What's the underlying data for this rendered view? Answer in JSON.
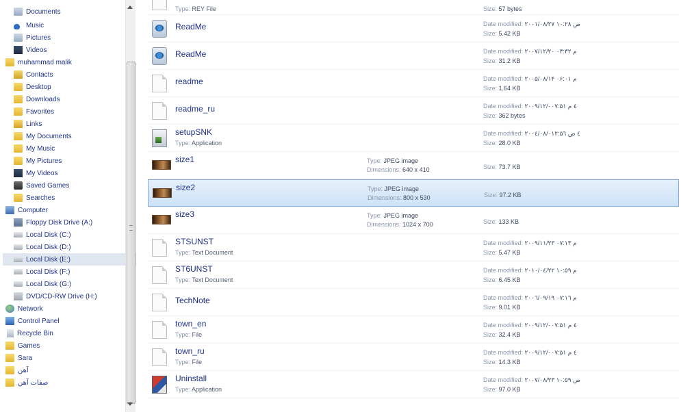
{
  "nav": {
    "items": [
      {
        "label": "Documents",
        "icon": "documents-library-icon",
        "selected": false
      },
      {
        "label": "Music",
        "icon": "music-library-icon",
        "selected": false
      },
      {
        "label": "Pictures",
        "icon": "pictures-library-icon",
        "selected": false
      },
      {
        "label": "Videos",
        "icon": "videos-library-icon",
        "selected": false
      },
      {
        "label": "muhammad malik",
        "icon": "user-folder-icon",
        "selected": false
      },
      {
        "label": "Contacts",
        "icon": "contacts-folder-icon",
        "selected": false
      },
      {
        "label": "Desktop",
        "icon": "desktop-folder-icon",
        "selected": false
      },
      {
        "label": "Downloads",
        "icon": "downloads-folder-icon",
        "selected": false
      },
      {
        "label": "Favorites",
        "icon": "favorites-folder-icon",
        "selected": false
      },
      {
        "label": "Links",
        "icon": "links-folder-icon",
        "selected": false
      },
      {
        "label": "My Documents",
        "icon": "folder-icon",
        "selected": false
      },
      {
        "label": "My Music",
        "icon": "folder-icon",
        "selected": false
      },
      {
        "label": "My Pictures",
        "icon": "folder-icon",
        "selected": false
      },
      {
        "label": "My Videos",
        "icon": "videos-folder-icon",
        "selected": false
      },
      {
        "label": "Saved Games",
        "icon": "saved-games-folder-icon",
        "selected": false
      },
      {
        "label": "Searches",
        "icon": "searches-folder-icon",
        "selected": false
      },
      {
        "label": "Computer",
        "icon": "computer-icon",
        "selected": false
      },
      {
        "label": "Floppy Disk Drive (A:)",
        "icon": "floppy-drive-icon",
        "selected": false
      },
      {
        "label": "Local Disk (C:)",
        "icon": "drive-icon",
        "selected": false
      },
      {
        "label": "Local Disk (D:)",
        "icon": "drive-icon",
        "selected": false
      },
      {
        "label": "Local Disk (E:)",
        "icon": "drive-icon",
        "selected": true
      },
      {
        "label": "Local Disk (F:)",
        "icon": "drive-icon",
        "selected": false
      },
      {
        "label": "Local Disk (G:)",
        "icon": "drive-icon",
        "selected": false
      },
      {
        "label": "DVD/CD-RW Drive (H:)",
        "icon": "dvd-drive-icon",
        "selected": false
      },
      {
        "label": "Network",
        "icon": "network-icon",
        "selected": false
      },
      {
        "label": "Control Panel",
        "icon": "control-panel-icon",
        "selected": false
      },
      {
        "label": "Recycle Bin",
        "icon": "recycle-bin-icon",
        "selected": false
      },
      {
        "label": "Games",
        "icon": "folder-icon",
        "selected": false
      },
      {
        "label": "Sara",
        "icon": "folder-icon",
        "selected": false
      },
      {
        "label": "آهن",
        "icon": "folder-icon",
        "selected": false
      },
      {
        "label": "صفات آهن",
        "icon": "folder-icon",
        "selected": false
      }
    ]
  },
  "files": [
    {
      "name": "",
      "type_label": "Type:",
      "type": "REY File",
      "size_label": "Size:",
      "size": "57 bytes",
      "icon": "document-icon"
    },
    {
      "name": "ReadMe",
      "date_label": "Date modified:",
      "date": "۲۰۰۱/۰۸/۲۷ ص ۱۰:۲۸",
      "size_label": "Size:",
      "size": "5.42 KB",
      "icon": "readme-icon"
    },
    {
      "name": "ReadMe",
      "date_label": "Date modified:",
      "date": "۲۰۰۷/۱۲/۲۰ م ۰۳:۳۲",
      "size_label": "Size:",
      "size": "31.2 KB",
      "icon": "readme-icon"
    },
    {
      "name": "readme",
      "date_label": "Date modified:",
      "date": "۲۰۰۵/۰۸/۱۴ م ۰۶:۰۱",
      "size_label": "Size:",
      "size": "1.64 KB",
      "icon": "document-icon"
    },
    {
      "name": "readme_ru",
      "date_label": "Date modified:",
      "date": "۲۰۰۹/۱۲/۰٤ م ۰۷:۵۱",
      "size_label": "Size:",
      "size": "362 bytes",
      "icon": "document-icon"
    },
    {
      "name": "setupSNK",
      "type_label": "Type:",
      "type": "Application",
      "date_label": "Date modified:",
      "date": "۲۰۰٤/۰۸/۰٤ ص ۱۲:۵٦",
      "size_label": "Size:",
      "size": "28.0 KB",
      "icon": "application-icon"
    },
    {
      "name": "size1",
      "mid_type_label": "Type:",
      "mid_type": "JPEG image",
      "dim_label": "Dimensions:",
      "dim": "640 x 410",
      "size_label": "Size:",
      "size": "73.7 KB",
      "icon": "jpeg-image-icon"
    },
    {
      "name": "size2",
      "mid_type_label": "Type:",
      "mid_type": "JPEG image",
      "dim_label": "Dimensions:",
      "dim": "800 x 530",
      "size_label": "Size:",
      "size": "97.2 KB",
      "icon": "jpeg-image-icon",
      "selected": true
    },
    {
      "name": "size3",
      "mid_type_label": "Type:",
      "mid_type": "JPEG image",
      "dim_label": "Dimensions:",
      "dim": "1024 x 700",
      "size_label": "Size:",
      "size": "133 KB",
      "icon": "jpeg-image-icon"
    },
    {
      "name": "STSUNST",
      "type_label": "Type:",
      "type": "Text Document",
      "date_label": "Date modified:",
      "date": "۲۰۰۹/۱۱/۲۳ م ۰۷:۱۳",
      "size_label": "Size:",
      "size": "5.47 KB",
      "icon": "text-document-icon"
    },
    {
      "name": "ST6UNST",
      "type_label": "Type:",
      "type": "Text Document",
      "date_label": "Date modified:",
      "date": "۲۰۱۰/۰٤/۲۲ م ۱۰:۵۹",
      "size_label": "Size:",
      "size": "6.45 KB",
      "icon": "text-document-icon"
    },
    {
      "name": "TechNote",
      "date_label": "Date modified:",
      "date": "۲۰۰٦/۰۹/۱۹ م ۰۷:۱٦",
      "size_label": "Size:",
      "size": "9.01 KB",
      "icon": "document-icon"
    },
    {
      "name": "town_en",
      "type_label": "Type:",
      "type": "File",
      "date_label": "Date modified:",
      "date": "۲۰۰۹/۱۲/۰٤ م ۰۷:۵۱",
      "size_label": "Size:",
      "size": "32.4 KB",
      "icon": "file-icon"
    },
    {
      "name": "town_ru",
      "type_label": "Type:",
      "type": "File",
      "date_label": "Date modified:",
      "date": "۲۰۰۹/۱۲/۰٤ م ۰۷:۵۱",
      "size_label": "Size:",
      "size": "14.3 KB",
      "icon": "file-icon"
    },
    {
      "name": "Uninstall",
      "type_label": "Type:",
      "type": "Application",
      "date_label": "Date modified:",
      "date": "۲۰۰۷/۰۸/۲۳ ص ۱۰:۵۹",
      "size_label": "Size:",
      "size": "97.0 KB",
      "icon": "uninstall-application-icon"
    }
  ]
}
